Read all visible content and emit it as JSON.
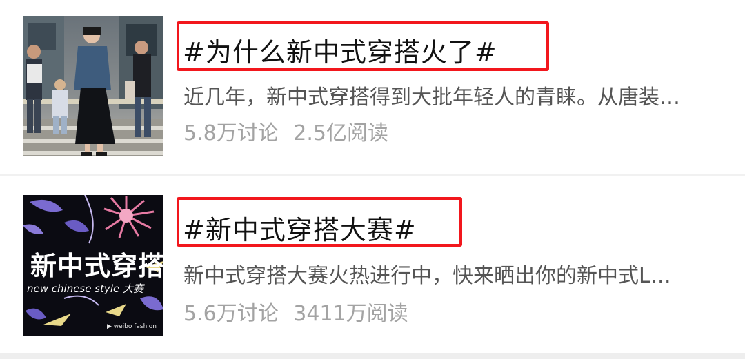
{
  "topics": [
    {
      "title": "#为什么新中式穿搭火了#",
      "description": "近几年，新中式穿搭得到大批年轻人的青睐。从唐装…",
      "discussions": "5.8万讨论",
      "reads": "2.5亿阅读",
      "thumbnail": "street-fashion-photo"
    },
    {
      "title": "#新中式穿搭大赛#",
      "description": "新中式穿搭大赛火热进行中，快来晒出你的新中式L…",
      "discussions": "5.6万讨论",
      "reads": "3411万阅读",
      "thumbnail": {
        "main_text": "新中式穿搭",
        "sub_text": "new chinese style 大赛",
        "brand_text": "▶ weibo fashion"
      }
    }
  ],
  "colors": {
    "highlight_border": "#f2171d",
    "title_text": "#111111",
    "description_text": "#555555",
    "stats_text": "#a3a3a3"
  }
}
